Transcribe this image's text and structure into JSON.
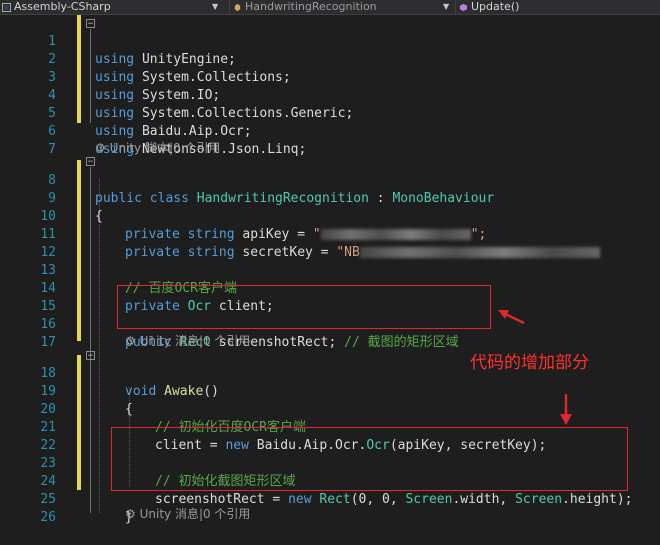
{
  "navbar": {
    "project": "Assembly-CSharp",
    "class_scope": "HandwritingRecognition",
    "member_scope": "Update()"
  },
  "hints": {
    "class_hint": "Unity 脚本|0 个引用",
    "awake_hint": "Unity 消息|0 个引用",
    "bottom_hint": "Unity 消息|0 个引用"
  },
  "code": {
    "l1_kw": "using",
    "l1_ns": " UnityEngine;",
    "l2_kw": "using",
    "l2_ns": " System.Collections;",
    "l3_kw": "using",
    "l3_ns": " System.IO;",
    "l4_kw": "using",
    "l4_ns": " System.Collections.Generic;",
    "l5_kw": "using",
    "l5_ns": " Baidu.Aip.Ocr;",
    "l6_kw": "using",
    "l6_ns": " Newtonsoft.Json.Linq;",
    "l8_public": "public",
    "l8_class": " class ",
    "l8_name": "HandwritingRecognition",
    "l8_colon": " : ",
    "l8_base": "MonoBehaviour",
    "l9": "{",
    "l10_private": "private",
    "l10_type": " string",
    "l10_rest": " apiKey = ",
    "l10_str": "\"",
    "l10_end": "\";",
    "l11_private": "private",
    "l11_type": " string",
    "l11_rest": " secretKey = ",
    "l11_str": "\"NB",
    "l13_comment": "// 百度OCR客户端",
    "l14_private": "private",
    "l14_type": " Ocr",
    "l14_rest": " client;",
    "l16_public": "public",
    "l16_type": " Rect",
    "l16_rest": " screenshotRect; ",
    "l16_comment": "// 截图的矩形区域",
    "l18_void": "void",
    "l18_method": " Awake",
    "l18_paren": "()",
    "l19": "{",
    "l20_comment": "// 初始化百度OCR客户端",
    "l21_a": "client = ",
    "l21_new": "new",
    "l21_b": " Baidu.Aip.Ocr.",
    "l21_type": "Ocr",
    "l21_c": "(apiKey, secretKey);",
    "l23_comment": "// 初始化截图矩形区域",
    "l24_a": "screenshotRect = ",
    "l24_new": "new",
    "l24_sp": " ",
    "l24_rect": "Rect",
    "l24_b": "(0, 0, ",
    "l24_screen1": "Screen",
    "l24_c": ".width, ",
    "l24_screen2": "Screen",
    "l24_d": ".height);",
    "l25": "}"
  },
  "line_numbers": [
    "1",
    "2",
    "3",
    "4",
    "5",
    "6",
    "7",
    "8",
    "9",
    "10",
    "11",
    "12",
    "13",
    "14",
    "15",
    "16",
    "17",
    "18",
    "19",
    "20",
    "21",
    "22",
    "23",
    "24",
    "25",
    "26"
  ],
  "annotation": {
    "label": "代码的增加部分",
    "color": "#e0262e"
  },
  "colors": {
    "background": "#1e1e1e",
    "keyword": "#569cd6",
    "type": "#4ec9b0",
    "string": "#d69d85",
    "comment": "#57a64a",
    "method": "#dcdcaa",
    "line_number": "#2b91af",
    "change_bar": "#e6d94c"
  }
}
